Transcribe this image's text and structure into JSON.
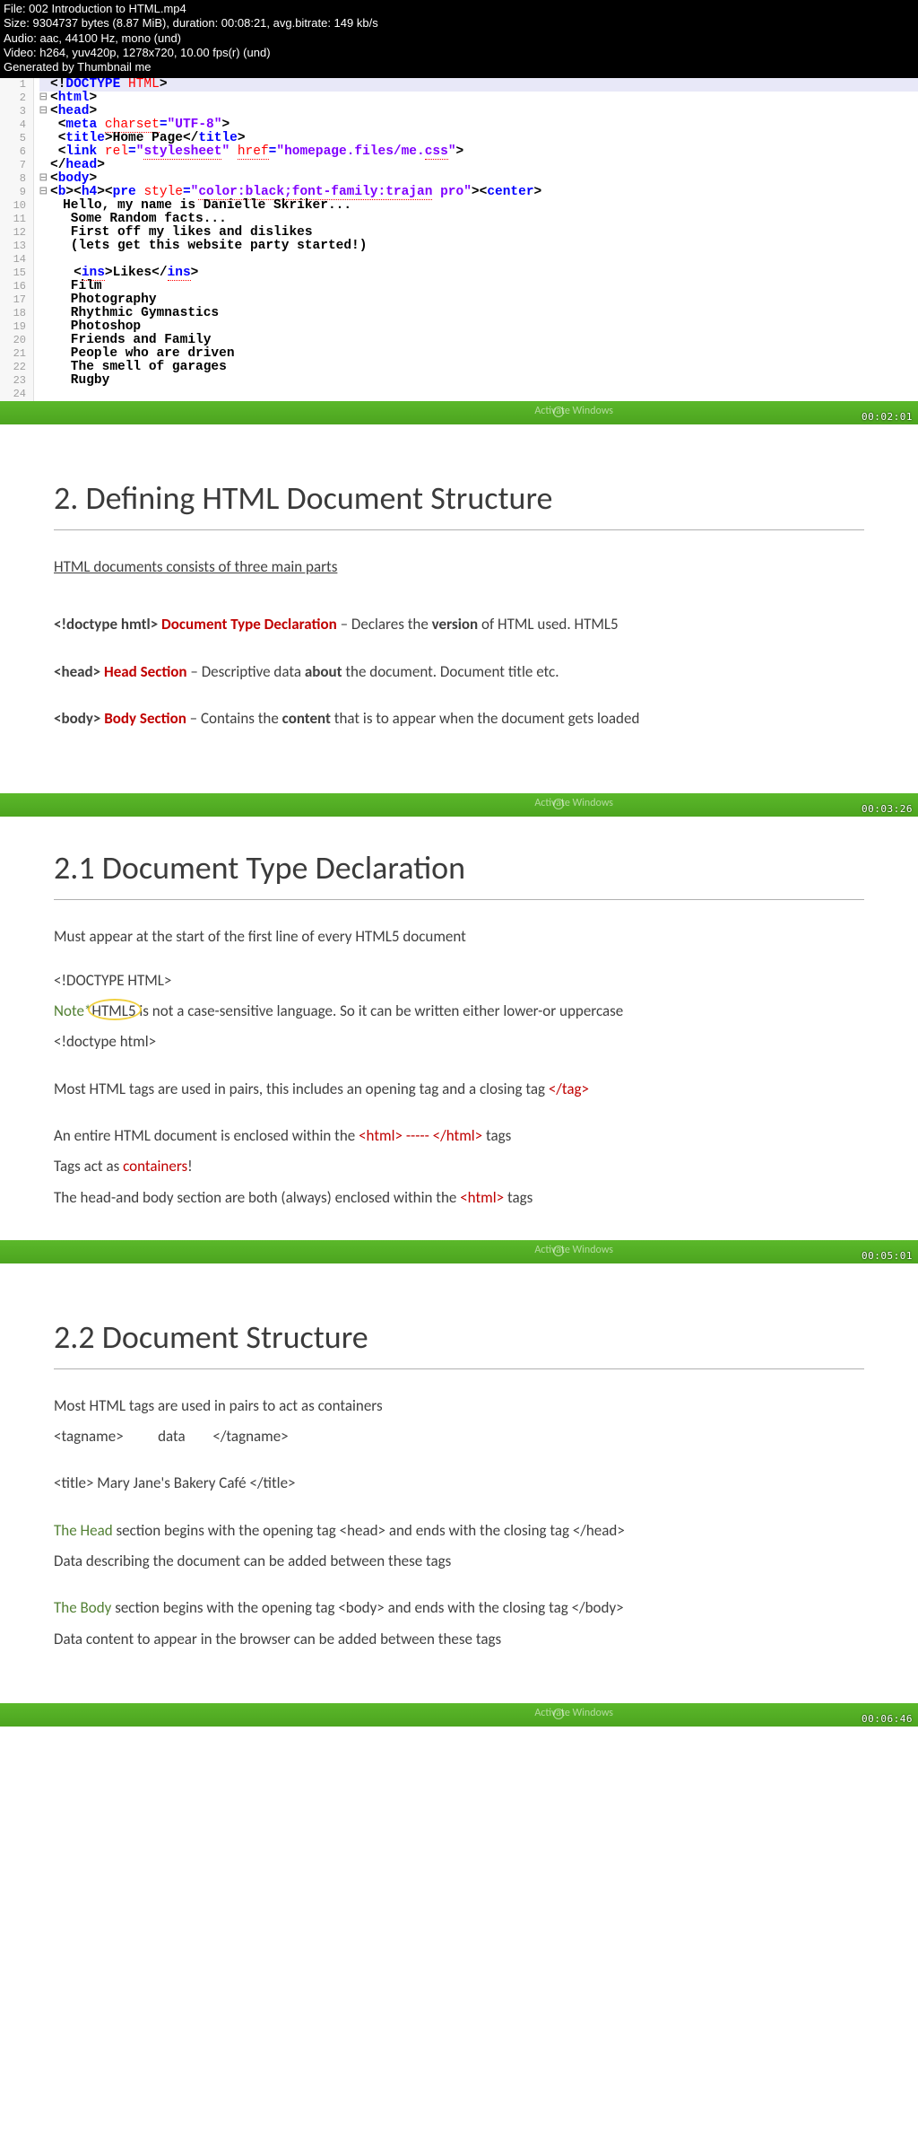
{
  "video_header": {
    "line1": "File: 002 Introduction to HTML.mp4",
    "line2": "Size: 9304737 bytes (8.87 MiB), duration: 00:08:21, avg.bitrate: 149 kb/s",
    "line3": "Audio: aac, 44100 Hz, mono (und)",
    "line4": "Video: h264, yuv420p, 1278x720, 10.00 fps(r) (und)",
    "line5": "Generated by Thumbnail me"
  },
  "line_numbers": [
    "1",
    "2",
    "3",
    "4",
    "5",
    "6",
    "7",
    "8",
    "9",
    "10",
    "11",
    "12",
    "13",
    "14",
    "15",
    "16",
    "17",
    "18",
    "19",
    "20",
    "21",
    "22",
    "23",
    "24"
  ],
  "code_plain": {
    "l10": "   Hello, my name is Danielle Skriker...",
    "l11": "    Some Random facts...",
    "l12": "    First off my likes and dislikes",
    "l13": "    (lets get this website party started!)",
    "l14": "",
    "l16": "    Film",
    "l17": "    Photography",
    "l18": "    Rhythmic Gymnastics",
    "l19": "    Photoshop",
    "l20": "    Friends and Family",
    "l21": "    People who are driven",
    "l22": "    The smell of garages",
    "l23": "    Rugby"
  },
  "bars": {
    "activate": "Activate Windows",
    "ts1": "00:02:01",
    "ts2": "00:03:26",
    "ts3": "00:05:01",
    "ts4": "00:06:46"
  },
  "slide2": {
    "title": "2. Defining HTML Document Structure",
    "sub": "HTML documents consists of three main parts",
    "dt_tag": "<!doctype hmtl>",
    "dt_name": "Document Type Declaration",
    "dt_rest1": " – Declares the ",
    "dt_bold": "version",
    "dt_rest2": " of HTML used. HTML5",
    "hd_tag": "<head>",
    "hd_name": "Head Section",
    "hd_rest1": " – Descriptive data ",
    "hd_bold": "about",
    "hd_rest2": " the document. Document title etc.",
    "bd_tag": "<body>",
    "bd_name": "Body Section",
    "bd_rest1": " – Contains the ",
    "bd_bold": "content",
    "bd_rest2": " that is to appear when the document gets loaded"
  },
  "slide21": {
    "title": "2.1 Document Type Declaration",
    "p1": "Must appear at the start of the first line of every HTML5 document",
    "p2": " <!DOCTYPE HTML>",
    "note_lbl": "Note*",
    "note_circ": " HTML5 is",
    "note_rest": " not a case-sensitive language. So it can be written either lower-or uppercase",
    "p3": " <!doctype html>",
    "p4a": "Most HTML tags are used in pairs, this includes an opening tag and a closing tag    ",
    "p4b": "</tag>",
    "p5a": "An entire HTML document is enclosed within the ",
    "p5b": "<html> ----- </html>",
    "p5c": " tags",
    "p6a": "Tags act as ",
    "p6b": "containers",
    "p6c": "!",
    "p7a": "The head-and body section are both (always) enclosed within the ",
    "p7b": "<html>",
    "p7c": " tags"
  },
  "slide22": {
    "title": "2.2 Document Structure",
    "p1": "Most HTML tags are used in pairs to act as containers",
    "p2": "<tagname>          data        </tagname>",
    "p3": "<title> Mary Jane's Bakery Café </title>",
    "hd_lbl": "The Head",
    "hd_rest": " section begins with the opening tag <head> and ends with the closing tag </head>",
    "hd2": "Data describing the document can be added between these tags",
    "bd_lbl": "The Body",
    "bd_rest": " section begins with the opening tag <body> and ends with the closing tag </body>",
    "bd2": "Data content to appear in the browser can be added between these tags"
  }
}
